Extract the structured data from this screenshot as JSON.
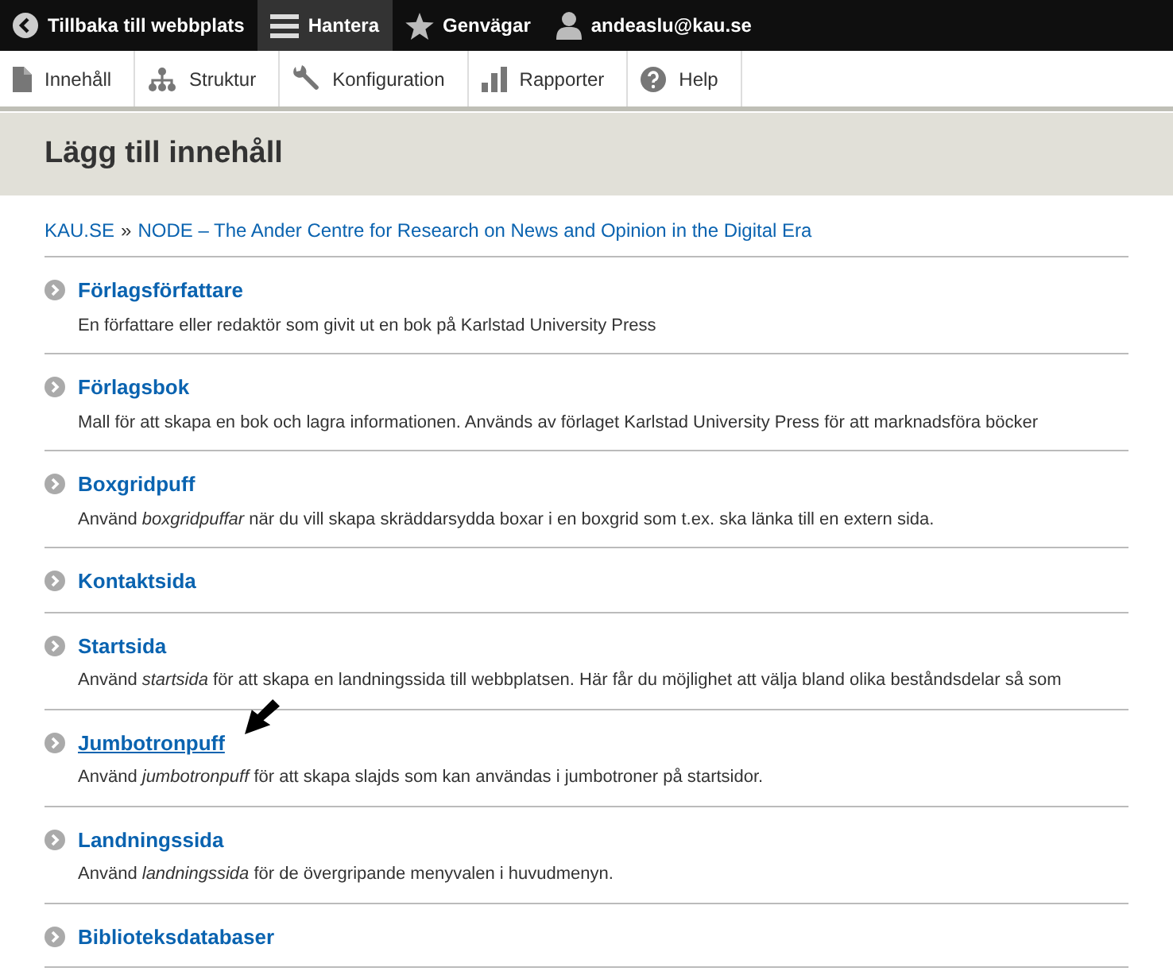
{
  "toolbar": {
    "items": [
      {
        "kind": "back",
        "label": "Tillbaka till webbplats",
        "selected": false
      },
      {
        "kind": "menu",
        "label": "Hantera",
        "selected": true
      },
      {
        "kind": "star",
        "label": "Genvägar",
        "selected": false
      },
      {
        "kind": "user",
        "label": "andeaslu@kau.se",
        "selected": false
      }
    ]
  },
  "tray": {
    "items": [
      {
        "kind": "page",
        "label": "Innehåll"
      },
      {
        "kind": "tree",
        "label": "Struktur"
      },
      {
        "kind": "wrench",
        "label": "Konfiguration"
      },
      {
        "kind": "bars",
        "label": "Rapporter"
      },
      {
        "kind": "help",
        "label": "Help"
      }
    ]
  },
  "page_title": "Lägg till innehåll",
  "breadcrumb": [
    {
      "label": "KAU.SE"
    },
    {
      "label": "»",
      "kind": "separator"
    },
    {
      "label": "NODE – The Ander Centre for Research on News and Opinion in the Digital Era"
    }
  ],
  "content_types": [
    {
      "title": "Förlagsförfattare",
      "description": "En författare eller redaktör som givit ut en bok på Karlstad University Press",
      "hovered": false
    },
    {
      "title": "Förlagsbok",
      "description": "Mall för att skapa en bok och lagra informationen. Används av förlaget Karlstad University Press för att marknadsföra böcker",
      "hovered": false
    },
    {
      "title": "Boxgridpuff",
      "description": "Använd *boxgridpuffar* när du vill skapa skräddarsydda boxar i en boxgrid som t.ex. ska länka till en extern sida.",
      "hovered": false
    },
    {
      "title": "Kontaktsida",
      "hovered": false
    },
    {
      "title": "Startsida",
      "description": "Använd *startsida* för att skapa en landningssida till webbplatsen. Här får du möjlighet att välja bland olika beståndsdelar så som",
      "hovered": false
    },
    {
      "title": "Jumbotronpuff",
      "description": "Använd *jumbotronpuff* för att skapa slajds som kan användas i jumbotroner på startsidor.",
      "hovered": true,
      "annotated": true
    },
    {
      "title": "Landningssida",
      "description": "Använd *landningssida* för de övergripande menyvalen i huvudmenyn.",
      "hovered": false
    },
    {
      "title": "Biblioteksdatabaser",
      "hovered": false
    }
  ]
}
